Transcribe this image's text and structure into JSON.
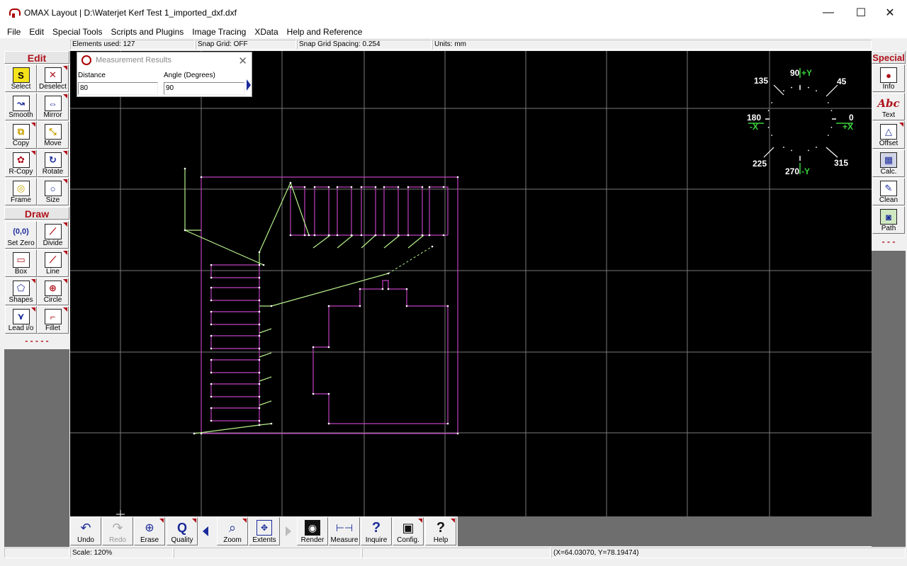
{
  "window": {
    "title": "OMAX Layout | D:\\Waterjet Kerf Test 1_imported_dxf.dxf",
    "minimize": "—",
    "maximize": "☐",
    "close": "✕"
  },
  "menu": [
    "File",
    "Edit",
    "Special Tools",
    "Scripts and Plugins",
    "Image Tracing",
    "XData",
    "Help and Reference"
  ],
  "status_top": {
    "elements": "Elements used: 127",
    "snap_grid": "Snap Grid: OFF",
    "snap_spacing": "Snap Grid Spacing: 0.254",
    "units": "Units: mm"
  },
  "measurement": {
    "title": "Measurement Results",
    "distance_label": "Distance",
    "distance_value": "80",
    "angle_label": "Angle (Degrees)",
    "angle_value": "90",
    "close": "✕"
  },
  "edit_panel": {
    "title": "Edit",
    "tools": [
      "Select",
      "Deselect",
      "Smooth",
      "Mirror",
      "Copy",
      "Move",
      "R-Copy",
      "Rotate",
      "Frame",
      "Size"
    ]
  },
  "draw_panel": {
    "title": "Draw",
    "tools": [
      "Set Zero",
      "Divide",
      "Box",
      "Line",
      "Shapes",
      "Circle",
      "Lead i/o",
      "Fillet"
    ],
    "dashes": "- - - - -"
  },
  "special_panel": {
    "title": "Special",
    "tools": [
      "Info",
      "Text",
      "Offset",
      "Calc.",
      "Clean",
      "Path"
    ],
    "dashes": "- - -"
  },
  "bottom_tools": [
    "Undo",
    "Redo",
    "Erase",
    "Quality",
    "Zoom",
    "Extents",
    "Render",
    "Measure",
    "Inquire",
    "Config.",
    "Help"
  ],
  "status_bottom": {
    "scale": "Scale: 120%",
    "coords": "(X=64.03070, Y=78.19474)"
  },
  "compass": {
    "labels": [
      "90",
      "+Y",
      "45",
      "135",
      "180",
      "-X",
      "0",
      "+X",
      "225",
      "270",
      "-Y",
      "315"
    ]
  },
  "colors": {
    "part": "#c040c0",
    "path": "#b6f08a",
    "grid": "#7a7a7a",
    "canvas": "#000000",
    "accent": "#b0111b"
  }
}
